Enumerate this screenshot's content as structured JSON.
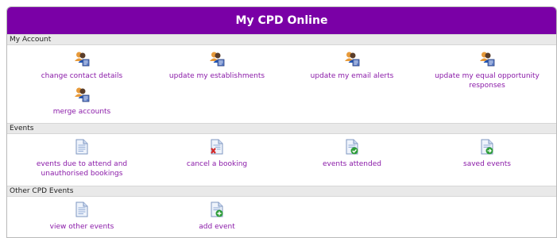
{
  "title": "My CPD Online",
  "sections": {
    "account": {
      "heading": "My Account",
      "items": [
        {
          "label": "change contact details",
          "icon": "users-icon"
        },
        {
          "label": "update my establishments",
          "icon": "users-icon"
        },
        {
          "label": "update my email alerts",
          "icon": "users-icon"
        },
        {
          "label": "update my equal opportunity responses",
          "icon": "users-icon"
        },
        {
          "label": "merge accounts",
          "icon": "users-icon"
        }
      ]
    },
    "events": {
      "heading": "Events",
      "items": [
        {
          "label": "events due to attend and unauthorised bookings",
          "icon": "document-icon"
        },
        {
          "label": "cancel a booking",
          "icon": "document-cancel-icon"
        },
        {
          "label": "events attended",
          "icon": "document-check-icon"
        },
        {
          "label": "saved events",
          "icon": "document-saved-icon"
        }
      ]
    },
    "other": {
      "heading": "Other CPD Events",
      "items": [
        {
          "label": "view other events",
          "icon": "document-icon"
        },
        {
          "label": "add event",
          "icon": "document-add-icon"
        }
      ]
    }
  },
  "colors": {
    "header": "#7a00a6",
    "link": "#8a1aa8"
  }
}
